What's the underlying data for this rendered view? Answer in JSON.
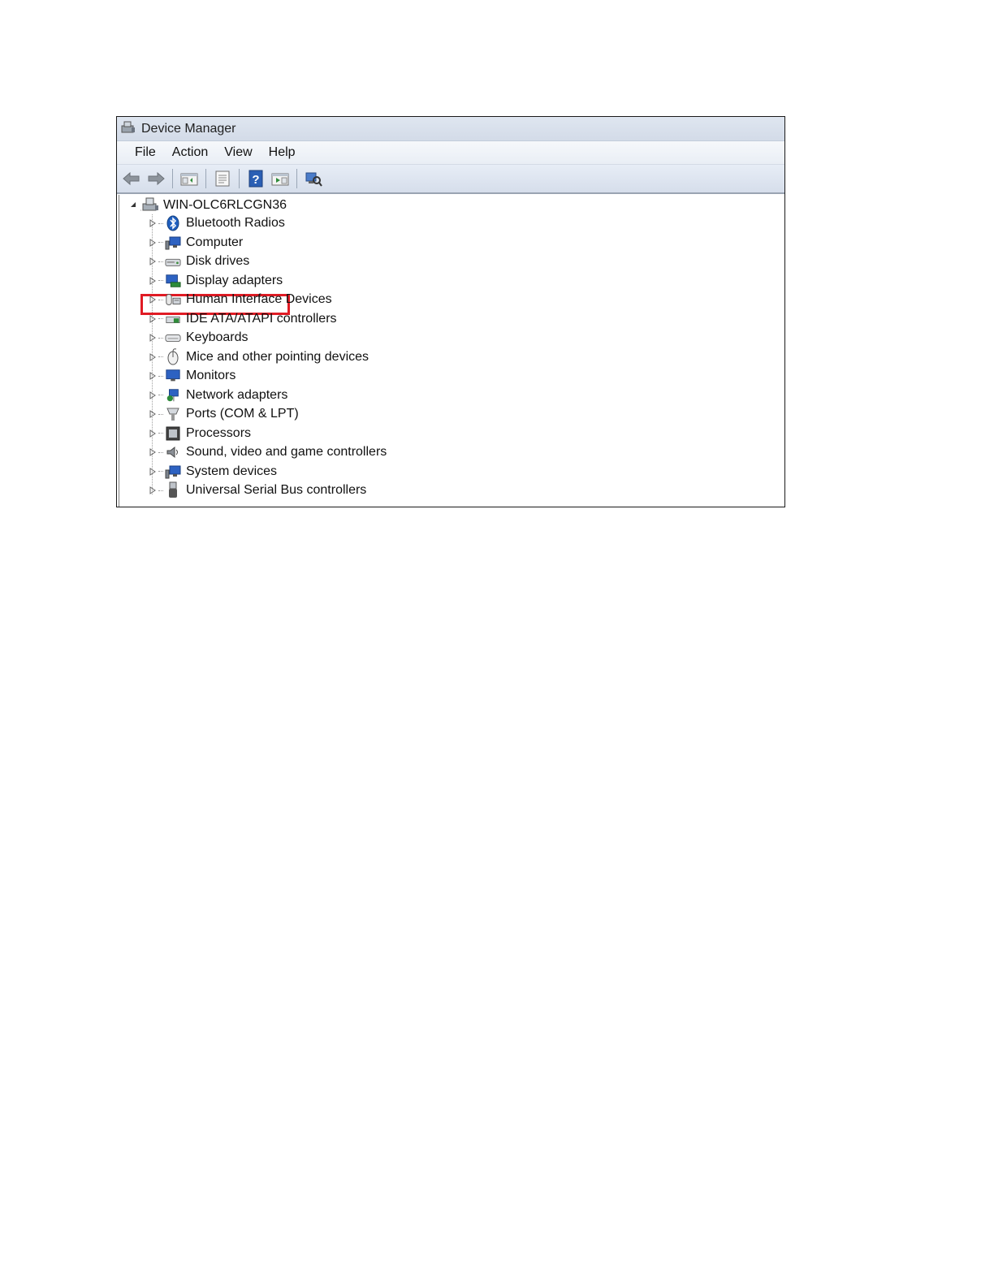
{
  "window": {
    "title": "Device Manager"
  },
  "menu": [
    "File",
    "Action",
    "View",
    "Help"
  ],
  "toolbar": {
    "icons": [
      "back-arrow-icon",
      "forward-arrow-icon",
      "show-hide-console-tree-icon",
      "properties-icon",
      "help-icon",
      "run-action-icon",
      "scan-hardware-changes-icon"
    ]
  },
  "tree": {
    "root": "WIN-OLC6RLCGN36",
    "items": [
      {
        "label": "Bluetooth Radios",
        "icon": "bluetooth-icon"
      },
      {
        "label": "Computer",
        "icon": "computer-icon"
      },
      {
        "label": "Disk drives",
        "icon": "disk-drive-icon"
      },
      {
        "label": "Display adapters",
        "icon": "display-adapter-icon"
      },
      {
        "label": "Human Interface Devices",
        "icon": "hid-icon"
      },
      {
        "label": "IDE ATA/ATAPI controllers",
        "icon": "ide-controller-icon"
      },
      {
        "label": "Keyboards",
        "icon": "keyboard-icon"
      },
      {
        "label": "Mice and other pointing devices",
        "icon": "mouse-icon"
      },
      {
        "label": "Monitors",
        "icon": "monitor-icon"
      },
      {
        "label": "Network adapters",
        "icon": "network-adapter-icon"
      },
      {
        "label": "Ports (COM & LPT)",
        "icon": "port-icon"
      },
      {
        "label": "Processors",
        "icon": "processor-icon"
      },
      {
        "label": "Sound, video and game controllers",
        "icon": "sound-icon"
      },
      {
        "label": "System devices",
        "icon": "system-devices-icon"
      },
      {
        "label": "Universal Serial Bus controllers",
        "icon": "usb-icon"
      }
    ]
  },
  "colors": {
    "highlight_border": "#e01b24",
    "toolbar_blue": "#2b5fb4"
  }
}
